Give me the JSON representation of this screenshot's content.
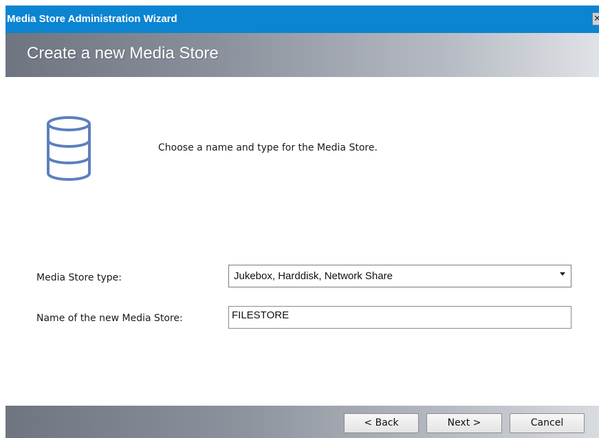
{
  "window": {
    "title": "Media Store Administration Wizard",
    "close_glyph": "✕"
  },
  "header": {
    "title": "Create a new Media Store"
  },
  "content": {
    "icon": "database-icon",
    "instruction": "Choose a name and type for the Media Store.",
    "type_label": "Media Store type:",
    "type_value": "Jukebox, Harddisk, Network Share",
    "name_label": "Name of the new Media Store:",
    "name_value": "FILESTORE"
  },
  "footer": {
    "back_label": "< Back",
    "next_label": "Next >",
    "cancel_label": "Cancel"
  },
  "colors": {
    "titlebar": "#0b84d2",
    "icon_stroke": "#5b7fc0"
  }
}
